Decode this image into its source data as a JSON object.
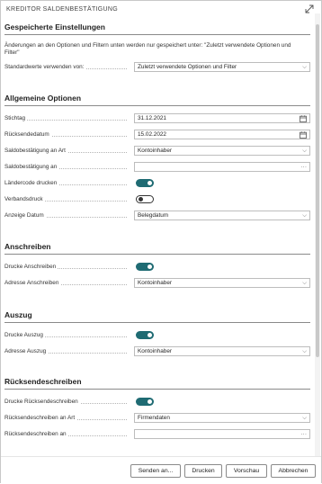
{
  "dialog": {
    "title": "KREDITOR SALDENBESTÄTIGUNG"
  },
  "saved": {
    "heading": "Gespeicherte Einstellungen",
    "note": "Änderungen an den Optionen und Filtern unten werden nur gespeichert unter: \"Zuletzt verwendete Optionen und Filter\"",
    "defaults_label": "Standardwerte verwenden von:",
    "defaults_value": "Zuletzt verwendete Optionen und Filter"
  },
  "general": {
    "heading": "Allgemeine Optionen",
    "stichtag_label": "Stichtag",
    "stichtag_value": "31.12.2021",
    "ruecksende_label": "Rücksendedatum",
    "ruecksende_value": "15.02.2022",
    "saldo_art_label": "Saldobestätigung an Art",
    "saldo_art_value": "Kontoinhaber",
    "saldo_an_label": "Saldobestätigung an",
    "saldo_an_value": "",
    "laendercode_label": "Ländercode drucken",
    "laendercode_on": true,
    "verband_label": "Verbandsdruck",
    "verband_on": false,
    "anzeige_label": "Anzeige Datum",
    "anzeige_value": "Belegdatum"
  },
  "anschreiben": {
    "heading": "Anschreiben",
    "drucke_label": "Drucke Anschreiben",
    "drucke_on": true,
    "adresse_label": "Adresse Anschreiben",
    "adresse_value": "Kontoinhaber"
  },
  "auszug": {
    "heading": "Auszug",
    "drucke_label": "Drucke Auszug",
    "drucke_on": true,
    "adresse_label": "Adresse Auszug",
    "adresse_value": "Kontoinhaber"
  },
  "ruecksendeschreiben": {
    "heading": "Rücksendeschreiben",
    "drucke_label": "Drucke Rücksendeschreiben",
    "drucke_on": true,
    "art_label": "Rücksendeschreiben an Art",
    "art_value": "Firmendaten",
    "an_label": "Rücksendeschreiben an",
    "an_value": ""
  },
  "footer": {
    "send_label": "Senden an...",
    "print_label": "Drucken",
    "preview_label": "Vorschau",
    "cancel_label": "Abbrechen"
  },
  "icons": {
    "expand": "expand-icon",
    "calendar": "calendar-icon",
    "dropdown": "chevron-down-icon",
    "lookup": "ellipsis-icon"
  },
  "colors": {
    "toggle_on": "#1f6b73"
  }
}
